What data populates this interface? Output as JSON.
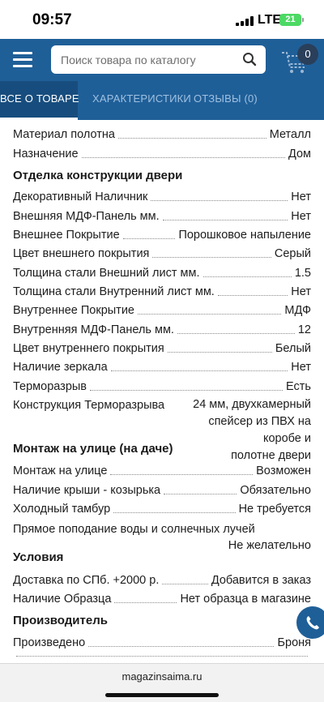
{
  "status_bar": {
    "time": "09:57",
    "network": "LTE",
    "battery": "21"
  },
  "header": {
    "search_placeholder": "Поиск товара по каталогу",
    "cart_count": "0"
  },
  "tabs": [
    {
      "label": "ВСЕ О ТОВАРЕ",
      "active": true
    },
    {
      "label": "ХАРАКТЕРИСТИКИ",
      "active": false
    },
    {
      "label": "ОТЗЫВЫ (0)",
      "active": false
    }
  ],
  "specs": {
    "general": [
      {
        "label": "Материал полотна",
        "value": "Металл"
      },
      {
        "label": "Назначение",
        "value": "Дом"
      }
    ],
    "finish_title": "Отделка конструкции двери",
    "finish": [
      {
        "label": "Декоративный Наличник",
        "value": "Нет"
      },
      {
        "label": "Внешняя МДФ-Панель мм.",
        "value": "Нет"
      },
      {
        "label": "Внешнее Покрытие",
        "value": "Порошковое напыление"
      },
      {
        "label": "Цвет внешнего покрытия",
        "value": "Серый"
      },
      {
        "label": "Толщина стали Внешний лист мм.",
        "value": "1.5"
      },
      {
        "label": "Толщина стали Внутренний лист мм.",
        "value": "Нет"
      },
      {
        "label": "Внутреннее Покрытие",
        "value": "МДФ"
      },
      {
        "label": "Внутренняя МДФ-Панель мм.",
        "value": "12"
      },
      {
        "label": "Цвет внутреннего покрытия",
        "value": "Белый"
      },
      {
        "label": "Наличие зеркала",
        "value": "Нет"
      },
      {
        "label": "Терморазрыв",
        "value": "Есть"
      }
    ],
    "thermal_break": {
      "label": "Конструкция Терморазрыва",
      "value_lines": [
        "24 мм, двухкамерный",
        "спейсер из ПВХ на коробе и",
        "полотне двери"
      ]
    },
    "outdoor_title": "Монтаж на улице (на даче)",
    "outdoor": [
      {
        "label": "Монтаж на улице",
        "value": "Возможен"
      },
      {
        "label": "Наличие крыши - козырька",
        "value": "Обязательно"
      },
      {
        "label": "Холодный тамбур",
        "value": "Не требуется"
      }
    ],
    "water": {
      "label": "Прямое поподание воды и солнечных лучей",
      "value": "Не желательно"
    },
    "conditions_title": "Условия",
    "conditions": [
      {
        "label": "Доставка по СПб. +2000 р.",
        "value": "Добавится в заказ"
      },
      {
        "label": "Наличие Образца",
        "value": "Нет образца в магазине"
      }
    ],
    "maker_title": "Производитель",
    "maker": [
      {
        "label": "Произведено",
        "value": "Броня"
      }
    ]
  },
  "footer": {
    "url": "magazinsaima.ru"
  }
}
